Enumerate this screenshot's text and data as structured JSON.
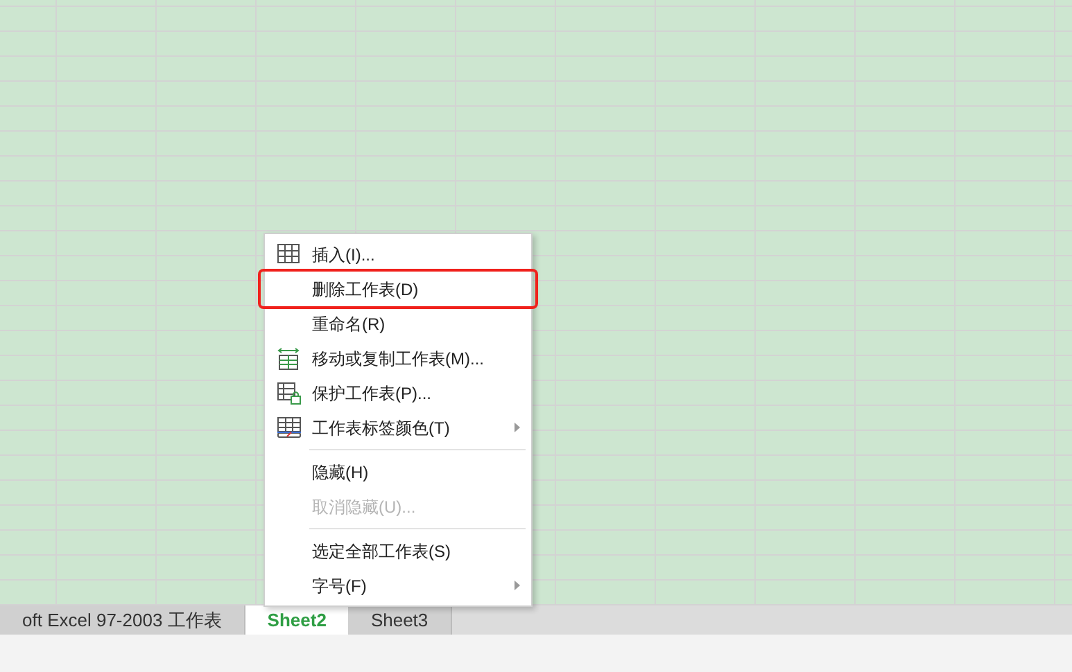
{
  "sheet_tabs": [
    {
      "label": "oft Excel 97-2003 工作表",
      "selected": false
    },
    {
      "label": "Sheet2",
      "selected": true
    },
    {
      "label": "Sheet3",
      "selected": false
    }
  ],
  "context_menu": {
    "items": [
      {
        "label": "插入(I)...",
        "kind": "table",
        "disabled": false,
        "submenu": false,
        "highlighted": false
      },
      {
        "label": "删除工作表(D)",
        "disabled": false,
        "submenu": false,
        "highlighted": true
      },
      {
        "label": "重命名(R)",
        "disabled": false,
        "submenu": false,
        "highlighted": false
      },
      {
        "label": "移动或复制工作表(M)...",
        "kind": "move",
        "disabled": false,
        "submenu": false,
        "highlighted": false
      },
      {
        "label": "保护工作表(P)...",
        "kind": "lock",
        "disabled": false,
        "submenu": false,
        "highlighted": false
      },
      {
        "label": "工作表标签颜色(T)",
        "kind": "color",
        "disabled": false,
        "submenu": true,
        "highlighted": false,
        "separator_after": true
      },
      {
        "label": "隐藏(H)",
        "disabled": false,
        "submenu": false,
        "highlighted": false
      },
      {
        "label": "取消隐藏(U)...",
        "disabled": true,
        "submenu": false,
        "highlighted": false,
        "separator_after": true
      },
      {
        "label": "选定全部工作表(S)",
        "disabled": false,
        "submenu": false,
        "highlighted": false
      },
      {
        "label": "字号(F)",
        "disabled": false,
        "submenu": true,
        "highlighted": false
      }
    ]
  }
}
